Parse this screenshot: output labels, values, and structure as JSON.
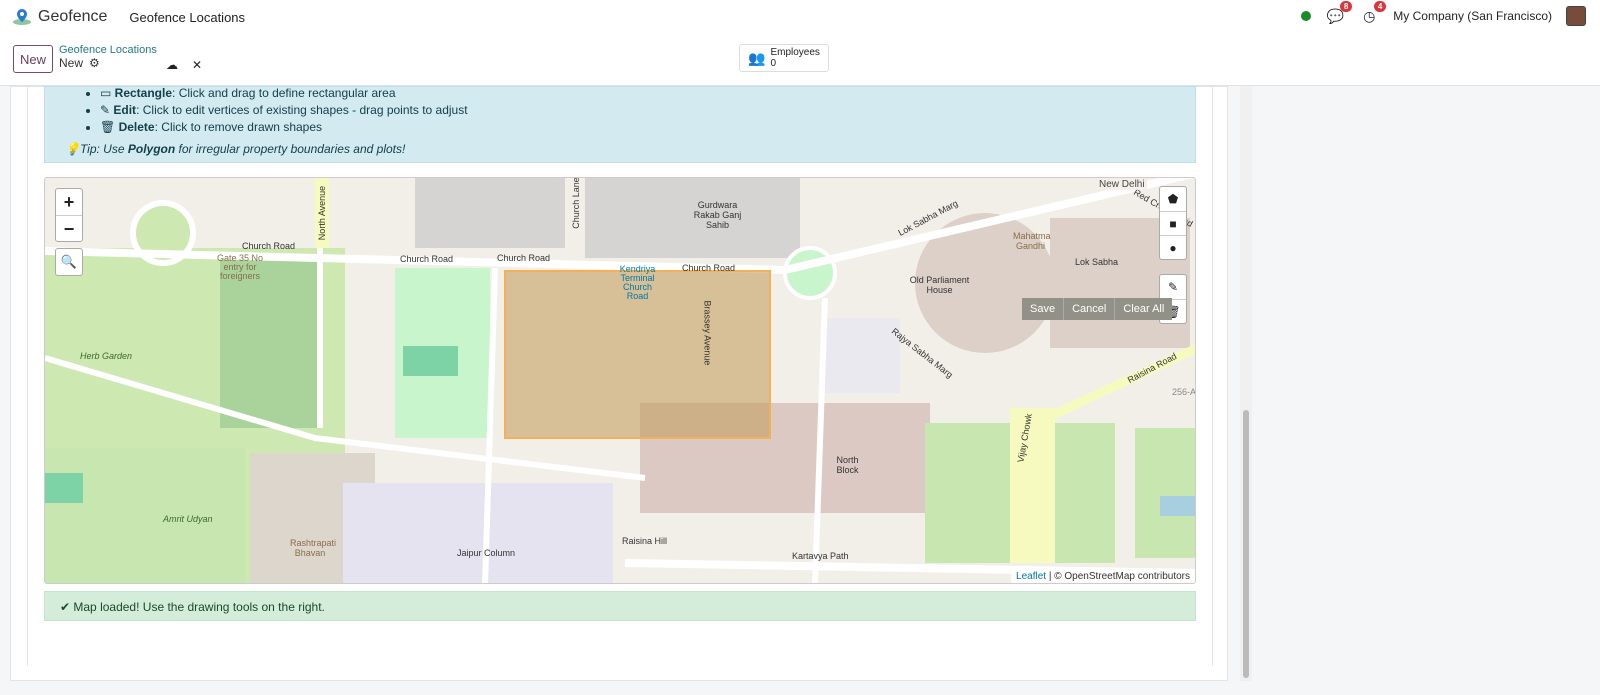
{
  "nav": {
    "app": "Geofence",
    "menu": "Geofence Locations",
    "company": "My Company (San Francisco)",
    "messages_count": "8",
    "activities_count": "4",
    "status_color": "#1a8a2a"
  },
  "control": {
    "new_label": "New",
    "breadcrumb_parent": "Geofence Locations",
    "breadcrumb_current": "New",
    "employees_label": "Employees",
    "employees_count": "0"
  },
  "info": {
    "items": [
      {
        "icon": "rectangle-icon",
        "title": "Rectangle",
        "text": ": Click and drag to define rectangular area"
      },
      {
        "icon": "pencil-icon",
        "title": "Edit",
        "text": ": Click to edit vertices of existing shapes - drag points to adjust"
      },
      {
        "icon": "trash-icon",
        "title": "Delete",
        "text": ": Click to remove drawn shapes"
      }
    ],
    "tip_prefix": "Tip: Use ",
    "tip_bold": "Polygon",
    "tip_suffix": " for irregular property boundaries and plots!"
  },
  "map": {
    "zoom_in": "+",
    "zoom_out": "−",
    "save": "Save",
    "cancel": "Cancel",
    "clear_all": "Clear All",
    "attribution_link": "Leaflet",
    "attribution_text": "| © OpenStreetMap contributors",
    "labels": [
      "Church Road",
      "Church Road",
      "Church Road",
      "Church Road",
      "Gate 35 No entry for foreigners",
      "North Avenue",
      "Church Lane",
      "Gurdwara Rakab Ganj Sahib",
      "Kendriya Terminal Church Road",
      "Brassey Avenue",
      "Lok Sabha Marg",
      "Mahatma Gandhi",
      "Old Parliament House",
      "Lok Sabha",
      "Raisina Road",
      "Red Cross Road",
      "Raisina Hill",
      "Kartavya Path",
      "North Block",
      "Amrit Udyan",
      "Herb Garden",
      "Rashtrapati Bhavan",
      "Jaipur Column",
      "Vijay Chowk",
      "Rajya Sabha Marg",
      "256-A",
      "New Delhi"
    ]
  },
  "status": {
    "message": "Map loaded! Use the drawing tools on the right."
  }
}
